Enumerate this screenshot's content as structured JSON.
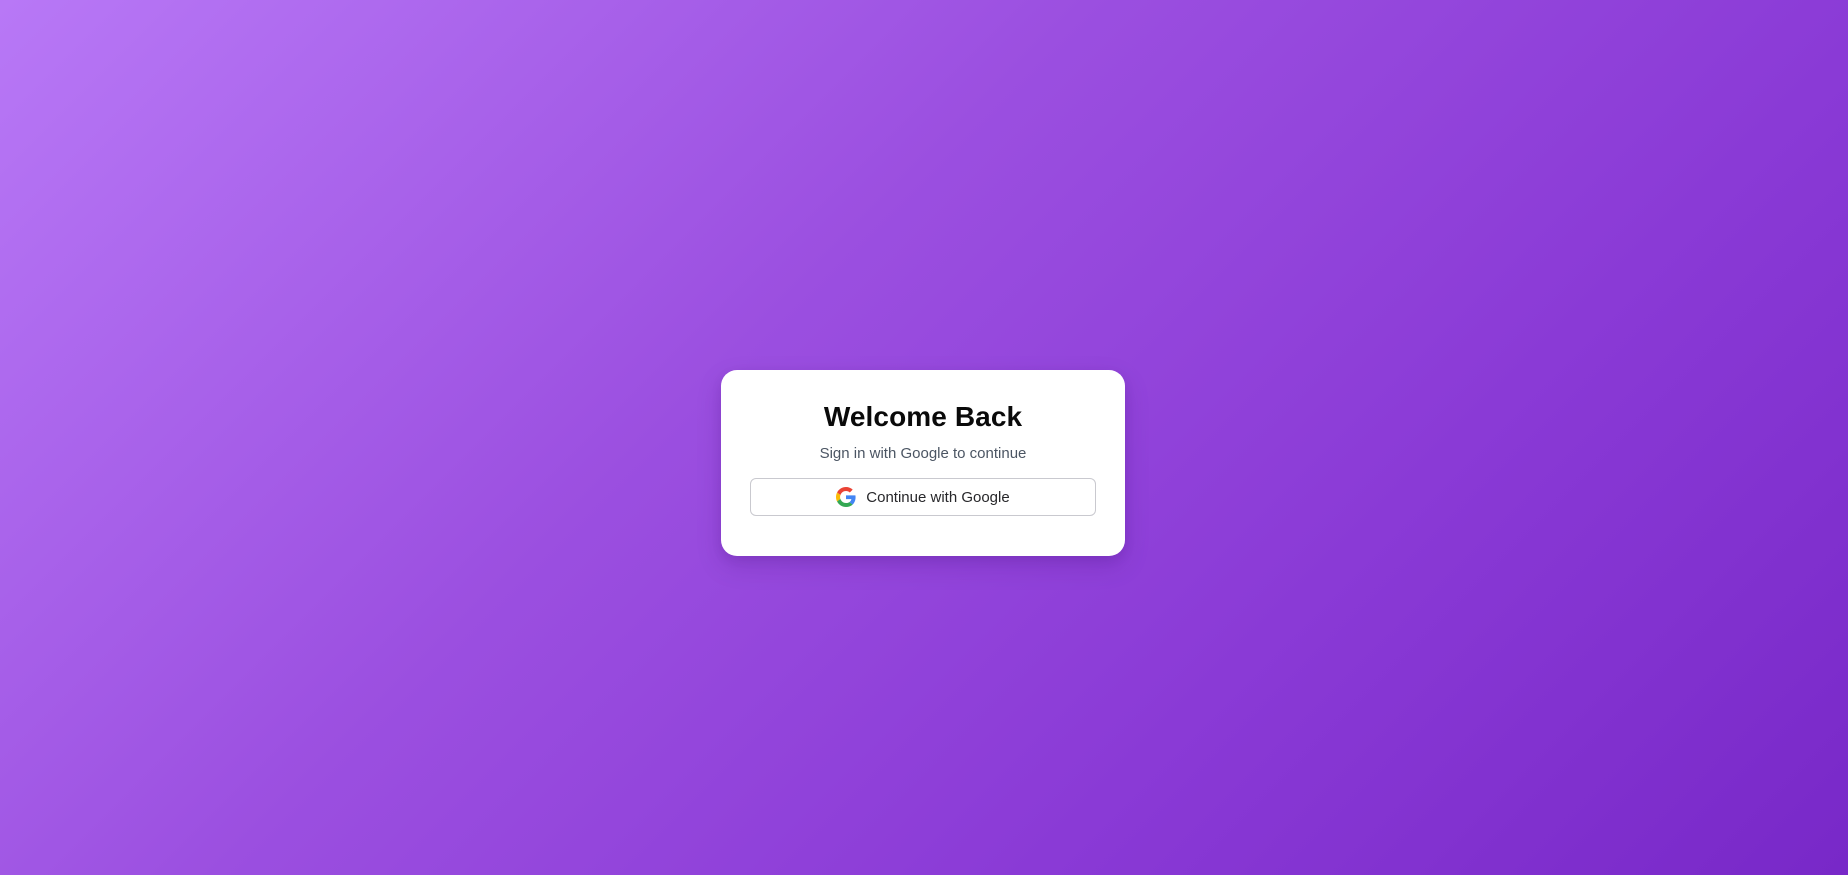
{
  "login": {
    "title": "Welcome Back",
    "subtitle": "Sign in with Google to continue",
    "google_button_label": "Continue with Google",
    "google_icon": "google-g-icon"
  },
  "colors": {
    "background_gradient_start": "#b878f6",
    "background_gradient_end": "#7828c8",
    "card_background": "#ffffff",
    "title_color": "#0a0a0a",
    "subtitle_color": "#4b5563"
  }
}
